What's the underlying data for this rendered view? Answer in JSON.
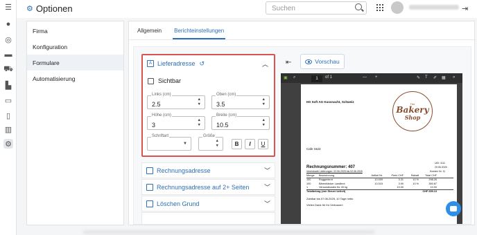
{
  "app": {
    "title": "Optionen"
  },
  "header": {
    "search_placeholder": "Suchen"
  },
  "sidebar": {
    "items": [
      {
        "label": "Firma"
      },
      {
        "label": "Konfiguration"
      },
      {
        "label": "Formulare"
      },
      {
        "label": "Automatisierung"
      }
    ]
  },
  "tabs": [
    {
      "label": "Allgemein"
    },
    {
      "label": "Berichteinstellungen"
    }
  ],
  "sections": {
    "lieferadresse": {
      "label": "Lieferadresse",
      "visible_label": "Sichtbar",
      "fields": {
        "links": {
          "label": "Links (cm)",
          "value": "2.5"
        },
        "oben": {
          "label": "Oben (cm)",
          "value": "3.5"
        },
        "hoehe": {
          "label": "Höhe (cm)",
          "value": "3"
        },
        "breite": {
          "label": "Breite (cm)",
          "value": "10.5"
        },
        "schriftart": {
          "label": "Schriftart",
          "value": ""
        },
        "groesse": {
          "label": "Größe",
          "value": ""
        }
      },
      "format_buttons": {
        "bold": "B",
        "italic": "I",
        "underline": "U"
      }
    },
    "others": [
      {
        "label": "Rechnungsadresse"
      },
      {
        "label": "Rechnungsadresse auf 2+ Seiten"
      },
      {
        "label": "Löschen Grund"
      }
    ]
  },
  "preview": {
    "button_label": "Vorschau",
    "page_number": "1",
    "page_total": "of 1",
    "zoom_minus": "—",
    "zoom_plus": "+",
    "document": {
      "sender": "HS Soft AG Kussnacht, Schweiz",
      "recipient": "Cafe Stolz",
      "logo_top": "The",
      "logo_main": "Bakery",
      "logo_sub": "Shop",
      "invoice_title": "Rechnungsnummer: 407",
      "invoice_subline": "Vereinbarte Lieferungen: 02.06.2025 bis 02.06.2025",
      "uid": "UID: 1111",
      "date": "29.05.2025",
      "customer_no": "Kunden Nr. 11",
      "table_headers": [
        "Menge",
        "Bezeichnung",
        "Artikel Nr.",
        "Preis CHF",
        "Rabatt",
        "Total CHF"
      ],
      "table_rows": [
        [
          "100",
          "Roggenbrot",
          "10.009",
          "3.31",
          "10 %",
          "298.26"
        ],
        [
          "100",
          "Bärenhäcker Landbrot",
          "10.015",
          "3.90",
          "10 %",
          "350.87"
        ],
        [
          "1",
          "Versandkosten für 45 kg",
          "",
          "10.00",
          "",
          "10.00"
        ]
      ],
      "total_label": "Totalbetrag (von Steuer befreit)",
      "total_value": "CHF 659.13",
      "payment_note": "Zahlbar bis 07.06.2025, 10 Tage netto",
      "thanks": "Vielen Dank für Ihr Vertrauen!"
    }
  }
}
